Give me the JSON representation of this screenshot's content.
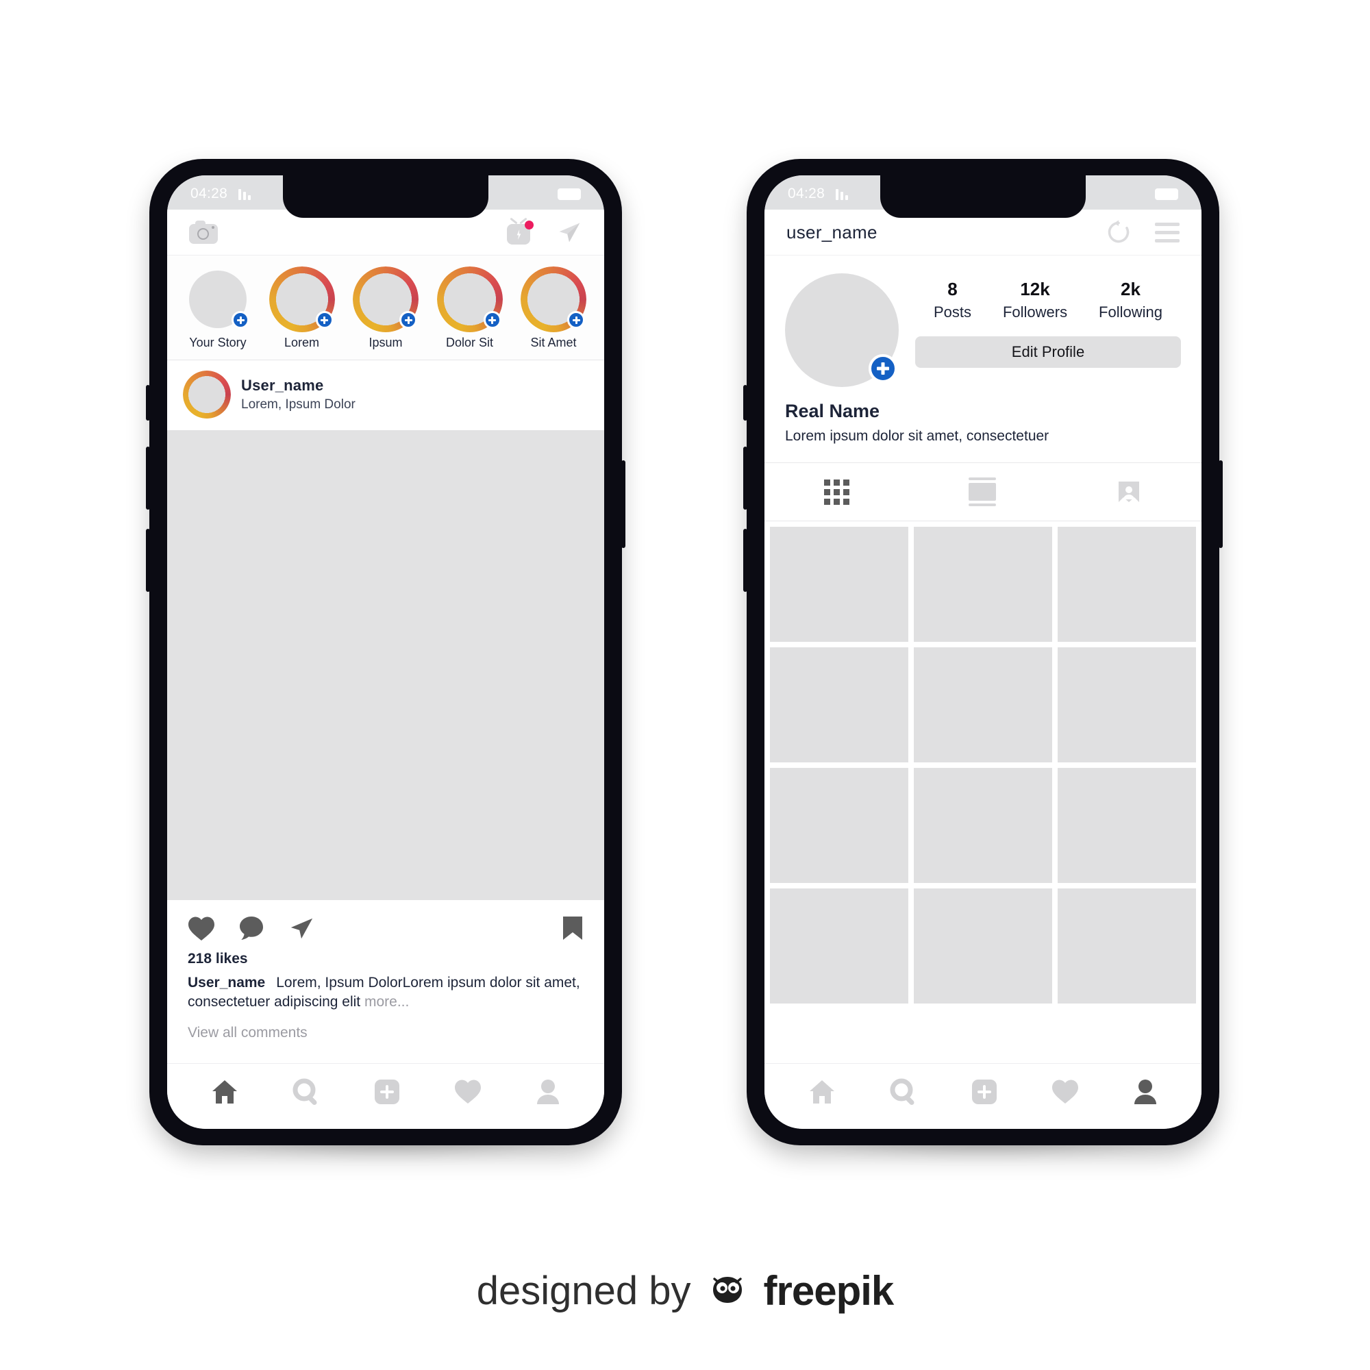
{
  "feed": {
    "status_bar": {
      "time": "04:28",
      "signal_icon": "signal-bars-icon",
      "battery_icon": "battery-icon"
    },
    "header": {
      "camera_icon": "camera-icon",
      "igtv_icon": "igtv-icon",
      "send_icon": "paper-plane-icon",
      "notification_dot_color": "#ec1c5f"
    },
    "stories": [
      {
        "label": "Your Story",
        "has_ring": false,
        "has_plus": true
      },
      {
        "label": "Lorem",
        "has_ring": true,
        "has_plus": true
      },
      {
        "label": "Ipsum",
        "has_ring": true,
        "has_plus": true
      },
      {
        "label": "Dolor Sit",
        "has_ring": true,
        "has_plus": true
      },
      {
        "label": "Sit Amet",
        "has_ring": true,
        "has_plus": true
      }
    ],
    "post": {
      "username": "User_name",
      "location": "Lorem, Ipsum Dolor",
      "likes": "218 likes",
      "caption_user": "User_name",
      "caption_text": "Lorem, Ipsum DolorLorem ipsum dolor sit amet, consectetuer adipiscing elit",
      "caption_more": "more...",
      "view_comments": "View all comments",
      "like_icon": "heart-icon",
      "comment_icon": "comment-bubble-icon",
      "share_icon": "paper-plane-icon",
      "save_icon": "bookmark-icon"
    },
    "tabbar": [
      {
        "name": "home-icon",
        "active": true
      },
      {
        "name": "search-icon",
        "active": false
      },
      {
        "name": "add-post-icon",
        "active": false
      },
      {
        "name": "activity-heart-icon",
        "active": false
      },
      {
        "name": "profile-person-icon",
        "active": false
      }
    ]
  },
  "profile": {
    "status_bar": {
      "time": "04:28",
      "signal_icon": "signal-bars-icon",
      "battery_icon": "battery-icon"
    },
    "header": {
      "title": "user_name",
      "refresh_icon": "refresh-circular-arrow-icon",
      "menu_icon": "hamburger-menu-icon"
    },
    "avatar_plus_icon": "add-story-plus-icon",
    "stats": [
      {
        "value": "8",
        "label": "Posts"
      },
      {
        "value": "12k",
        "label": "Followers"
      },
      {
        "value": "2k",
        "label": "Following"
      }
    ],
    "edit_profile_label": "Edit Profile",
    "bio_name": "Real Name",
    "bio_text": "Lorem ipsum dolor sit amet, consectetuer",
    "tabs": [
      {
        "name": "grid-view-icon",
        "active": true
      },
      {
        "name": "list-view-icon",
        "active": false
      },
      {
        "name": "tagged-photos-icon",
        "active": false
      }
    ],
    "grid_cells": 12,
    "tabbar": [
      {
        "name": "home-icon",
        "active": false
      },
      {
        "name": "search-icon",
        "active": false
      },
      {
        "name": "add-post-icon",
        "active": false
      },
      {
        "name": "activity-heart-icon",
        "active": false
      },
      {
        "name": "profile-person-icon",
        "active": true
      }
    ]
  },
  "footer": {
    "designed_by": "designed by",
    "brand": "freepik",
    "logo_icon": "freepik-mascot-icon"
  },
  "colors": {
    "accent_blue": "#1460c4",
    "story_ring_start": "#e8b22a",
    "story_ring_end": "#c9434f",
    "notification": "#ec1c5f",
    "placeholder_gray": "#e0e0e1"
  }
}
